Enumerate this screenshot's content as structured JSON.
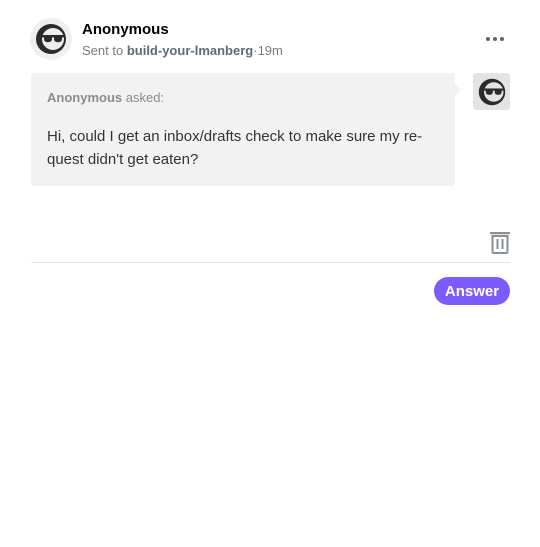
{
  "header": {
    "sender_name": "Anonymous",
    "sent_to_prefix": "Sent to",
    "blog_name": "build-your-lmanberg",
    "separator": "·",
    "time_ago": "19m",
    "more_icon": "more-horizontal-icon"
  },
  "ask": {
    "asker": "Anonymous",
    "asked_suffix": "asked:",
    "question": "Hi, could I get an inbox/drafts check to make sure my re-quest didn't get eaten?"
  },
  "avatar": {
    "icon": "anonymous-sunglasses-icon"
  },
  "actions": {
    "delete_icon": "trash-icon",
    "answer_label": "Answer"
  },
  "colors": {
    "accent": "#7c5cff",
    "bubble": "#f2f2f2",
    "muted_text": "#7a7a7a"
  }
}
